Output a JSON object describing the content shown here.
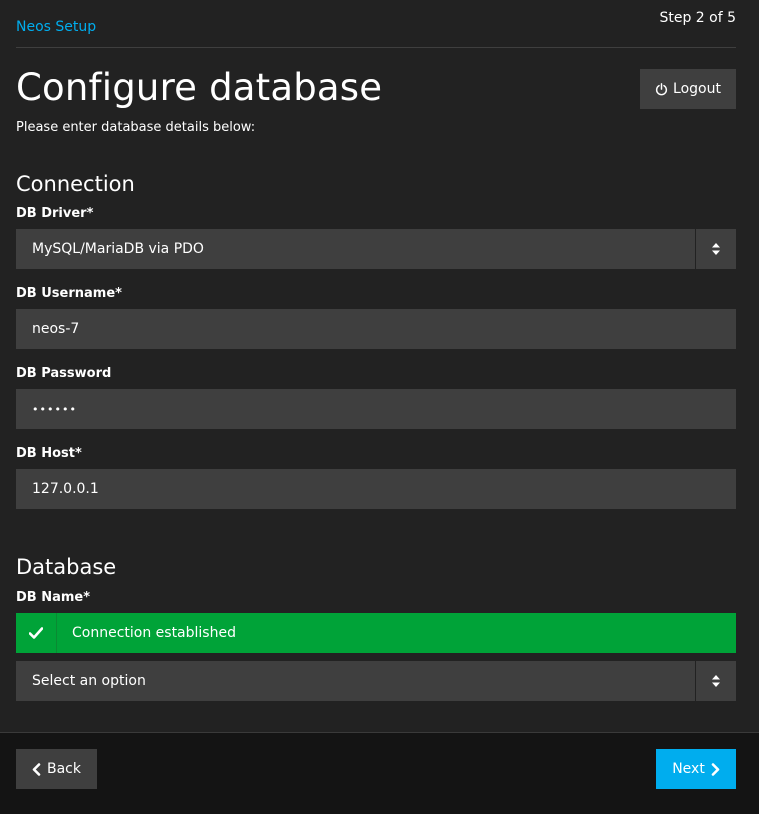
{
  "header": {
    "brand": "Neos Setup",
    "step": "Step 2 of 5"
  },
  "page": {
    "title": "Configure database",
    "subtitle": "Please enter database details below:",
    "logout_label": "Logout"
  },
  "connection": {
    "heading": "Connection",
    "driver": {
      "label": "DB Driver*",
      "value": "MySQL/MariaDB via PDO"
    },
    "username": {
      "label": "DB Username*",
      "value": "neos-7"
    },
    "password": {
      "label": "DB Password",
      "value": "••••••"
    },
    "host": {
      "label": "DB Host*",
      "value": "127.0.0.1"
    }
  },
  "database": {
    "heading": "Database",
    "name_label": "DB Name*",
    "status_message": "Connection established",
    "name_select_value": "Select an option"
  },
  "footer": {
    "back_label": "Back",
    "next_label": "Next"
  },
  "colors": {
    "background": "#222222",
    "input_bg": "#3f3f3f",
    "accent_blue": "#00adee",
    "success_green": "#00a338",
    "footer_bg": "#141414"
  },
  "icons": {
    "logout": "power-icon",
    "select": "sort-arrows-icon",
    "status": "checkmark-icon",
    "back": "chevron-left-icon",
    "next": "chevron-right-icon"
  }
}
